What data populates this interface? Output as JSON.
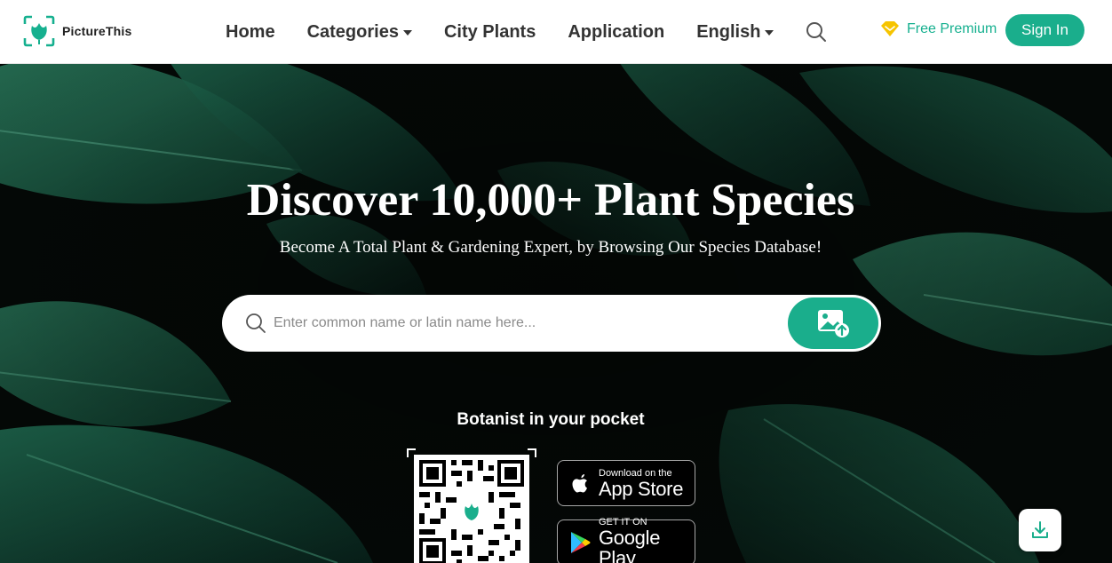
{
  "header": {
    "logo_text": "PictureThis",
    "nav": [
      {
        "label": "Home",
        "dropdown": false
      },
      {
        "label": "Categories",
        "dropdown": true
      },
      {
        "label": "City Plants",
        "dropdown": false
      },
      {
        "label": "Application",
        "dropdown": false
      },
      {
        "label": "English",
        "dropdown": true
      }
    ],
    "premium_label": "Free Premium",
    "signin_label": "Sign In"
  },
  "hero": {
    "title": "Discover 10,000+ Plant Species",
    "subtitle": "Become A Total Plant & Gardening Expert, by Browsing Our Species Database!",
    "search_placeholder": "Enter common name or latin name here...",
    "pocket_label": "Botanist in your pocket"
  },
  "stores": {
    "app_small": "Download on the",
    "app_big": "App Store",
    "play_small": "GET IT ON",
    "play_big": "Google Play"
  },
  "colors": {
    "accent": "#1aae8c",
    "premium_gold": "#f6c400",
    "header_bg": "#ffffff",
    "hero_dark": "#050a08"
  },
  "icons": {
    "logo": "picturethis-logo-icon",
    "search": "search-icon",
    "premium": "diamond-icon",
    "image_search": "image-upload-icon",
    "apple": "apple-icon",
    "google_play": "google-play-icon",
    "download": "download-icon"
  }
}
